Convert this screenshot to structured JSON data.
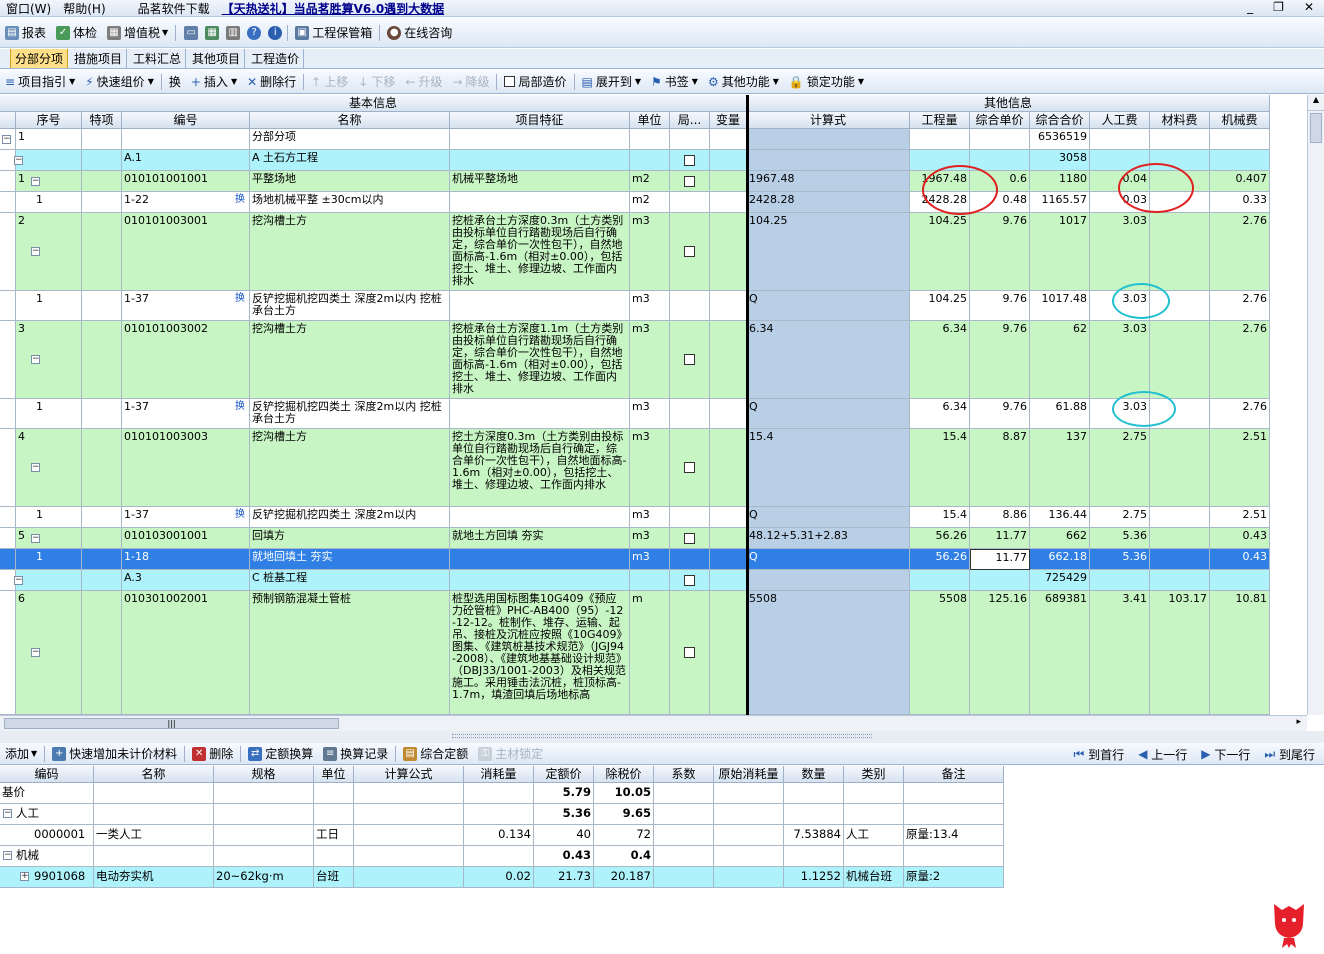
{
  "menu": {
    "items": [
      "窗口(W)",
      "帮助(H)",
      "品茗软件下载"
    ],
    "promo": "【天热送礼】当品茗胜算V6.0遇到大数据",
    "controls": [
      "_",
      "❐",
      "✕"
    ]
  },
  "toolbar1": [
    "报表",
    "体检",
    "增值税",
    "工程保管箱",
    "在线咨询"
  ],
  "tabs": [
    "分部分项",
    "措施项目",
    "工料汇总",
    "其他项目",
    "工程造价"
  ],
  "toolbar2": [
    {
      "label": "项目指引",
      "dd": true
    },
    {
      "label": "快速组价",
      "dd": true
    },
    {
      "label": "换"
    },
    {
      "label": "插入",
      "dd": true
    },
    {
      "label": "删除行"
    },
    {
      "label": "上移",
      "dis": true
    },
    {
      "label": "下移",
      "dis": true
    },
    {
      "label": "升级",
      "dis": true
    },
    {
      "label": "降级",
      "dis": true
    },
    {
      "label": "局部造价",
      "chk": true
    },
    {
      "label": "展开到",
      "dd": true
    },
    {
      "label": "书签",
      "dd": true
    },
    {
      "label": "其他功能",
      "dd": true
    },
    {
      "label": "锁定功能",
      "dd": true
    }
  ],
  "grid": {
    "group_basic": "基本信息",
    "group_other": "其他信息",
    "headers": [
      "序号",
      "特项",
      "编号",
      "名称",
      "项目特征",
      "单位",
      "局...",
      "变量",
      "计算式",
      "工程量",
      "综合单价",
      "综合合价",
      "人工费",
      "材料费",
      "机械费"
    ],
    "rows": [
      {
        "type": "root",
        "h": 21,
        "seq": "1",
        "name": "分部分项",
        "total": "6536519"
      },
      {
        "type": "section",
        "h": 21,
        "code": "A.1",
        "name": "A 土石方工程",
        "chk": true,
        "total": "3058"
      },
      {
        "type": "item",
        "h": 21,
        "seq": "1",
        "code": "010101001001",
        "name": "平整场地",
        "feat": "机械平整场地",
        "unit": "m2",
        "chk": true,
        "expr": "1967.48",
        "qty": "1967.48",
        "price": "0.6",
        "total": "1180",
        "labor": "0.04",
        "mat": "",
        "mach": "0.407"
      },
      {
        "type": "quota",
        "h": 21,
        "seq": "1",
        "code": "1-22",
        "huan": true,
        "name": "场地机械平整 ±30cm以内",
        "feat": "",
        "unit": "m2",
        "expr": "2428.28",
        "qty": "2428.28",
        "price": "0.48",
        "total": "1165.57",
        "labor": "0.03",
        "mat": "",
        "mach": "0.33"
      },
      {
        "type": "item",
        "h": 78,
        "seq": "2",
        "code": "010101003001",
        "name": "挖沟槽土方",
        "feat": "挖桩承台土方深度0.3m（土方类别由投标单位自行踏勘现场后自行确定，综合单价一次性包干），自然地面标高-1.6m（相对±0.00），包括挖土、堆土、修理边坡、工作面内排水",
        "unit": "m3",
        "chk": true,
        "expr": "104.25",
        "qty": "104.25",
        "price": "9.76",
        "total": "1017",
        "labor": "3.03",
        "mat": "",
        "mach": "2.76"
      },
      {
        "type": "quota",
        "h": 30,
        "seq": "1",
        "code": "1-37",
        "huan": true,
        "name": "反铲挖掘机挖四类土 深度2m以内 挖桩承台土方",
        "feat": "",
        "unit": "m3",
        "expr": "Q",
        "qty": "104.25",
        "price": "9.76",
        "total": "1017.48",
        "labor": "3.03",
        "mat": "",
        "mach": "2.76"
      },
      {
        "type": "item",
        "h": 78,
        "seq": "3",
        "code": "010101003002",
        "name": "挖沟槽土方",
        "feat": "挖桩承台土方深度1.1m（土方类别由投标单位自行踏勘现场后自行确定，综合单价一次性包干），自然地面标高-1.6m（相对±0.00），包括挖土、堆土、修理边坡、工作面内排水",
        "unit": "m3",
        "chk": true,
        "expr": "6.34",
        "qty": "6.34",
        "price": "9.76",
        "total": "62",
        "labor": "3.03",
        "mat": "",
        "mach": "2.76"
      },
      {
        "type": "quota",
        "h": 30,
        "seq": "1",
        "code": "1-37",
        "huan": true,
        "name": "反铲挖掘机挖四类土 深度2m以内 挖桩承台土方",
        "feat": "",
        "unit": "m3",
        "expr": "Q",
        "qty": "6.34",
        "price": "9.76",
        "total": "61.88",
        "labor": "3.03",
        "mat": "",
        "mach": "2.76"
      },
      {
        "type": "item",
        "h": 78,
        "seq": "4",
        "code": "010101003003",
        "name": "挖沟槽土方",
        "feat": "挖土方深度0.3m（土方类别由投标单位自行踏勘现场后自行确定，综合单价一次性包干），自然地面标高-1.6m（相对±0.00），包括挖土、堆土、修理边坡、工作面内排水",
        "unit": "m3",
        "chk": true,
        "expr": "15.4",
        "qty": "15.4",
        "price": "8.87",
        "total": "137",
        "labor": "2.75",
        "mat": "",
        "mach": "2.51"
      },
      {
        "type": "quota",
        "h": 21,
        "seq": "1",
        "code": "1-37",
        "huan": true,
        "name": "反铲挖掘机挖四类土 深度2m以内",
        "feat": "",
        "unit": "m3",
        "expr": "Q",
        "qty": "15.4",
        "price": "8.86",
        "total": "136.44",
        "labor": "2.75",
        "mat": "",
        "mach": "2.51"
      },
      {
        "type": "item",
        "h": 21,
        "seq": "5",
        "code": "010103001001",
        "name": "回填方",
        "feat": "就地土方回填 夯实",
        "unit": "m3",
        "chk": true,
        "expr": "48.12+5.31+2.83",
        "qty": "56.26",
        "price": "11.77",
        "total": "662",
        "labor": "5.36",
        "mat": "",
        "mach": "0.43"
      },
      {
        "type": "selected",
        "h": 21,
        "seq": "1",
        "code": "1-18",
        "name": "就地回填土 夯实",
        "feat": "",
        "unit": "m3",
        "expr": "Q",
        "qty": "56.26",
        "price": "11.77",
        "total": "662.18",
        "labor": "5.36",
        "mat": "",
        "mach": "0.43"
      },
      {
        "type": "section",
        "h": 21,
        "code": "A.3",
        "name": "C 桩基工程",
        "chk": true,
        "total": "725429"
      },
      {
        "type": "item",
        "h": 124,
        "seq": "6",
        "code": "010301002001",
        "name": "预制钢筋混凝土管桩",
        "feat": "桩型选用国标图集10G409《预应力砼管桩》PHC-AB400（95）-12-12-12。桩制作、堆存、运输、起吊、接桩及沉桩应按照《10G409》图集、《建筑桩基技术规范》（JGJ94-2008）、《建筑地基基础设计规范》（DBJ33/1001-2003）及相关规范施工。采用锤击法沉桩，桩顶标高-1.7m，填渣回填后场地标高",
        "unit": "m",
        "chk": true,
        "expr": "5508",
        "qty": "5508",
        "price": "125.16",
        "total": "689381",
        "labor": "3.41",
        "mat": "103.17",
        "mach": "10.81"
      }
    ]
  },
  "toolbar3": [
    "添加",
    "快速增加未计价材料",
    "删除",
    "定额换算",
    "换算记录",
    "综合定额",
    "主材锁定"
  ],
  "nav": [
    "到首行",
    "上一行",
    "下一行",
    "到尾行"
  ],
  "subgrid": {
    "headers": [
      "编码",
      "名称",
      "规格",
      "单位",
      "计算公式",
      "消耗量",
      "定额价",
      "除税价",
      "系数",
      "原始消耗量",
      "数量",
      "类别",
      "备注"
    ],
    "rows": [
      {
        "kind": "base",
        "code": "基价",
        "quota": "5.79",
        "notax": "10.05"
      },
      {
        "kind": "group",
        "code": "人工",
        "quota": "5.36",
        "notax": "9.65"
      },
      {
        "kind": "detail",
        "code": "0000001",
        "name": "一类人工",
        "spec": "",
        "unit": "工日",
        "use": "0.134",
        "quota": "40",
        "notax": "72",
        "count": "7.53884",
        "cat": "人工",
        "note": "原量:13.4"
      },
      {
        "kind": "group",
        "code": "机械",
        "quota": "0.43",
        "notax": "0.4"
      },
      {
        "kind": "sel",
        "code": "9901068",
        "name": "电动夯实机",
        "spec": "20~62kg·m",
        "unit": "台班",
        "use": "0.02",
        "quota": "21.73",
        "notax": "20.187",
        "count": "1.1252",
        "cat": "机械台班",
        "note": "原量:2"
      }
    ]
  },
  "colors": {
    "green": "#c8f5c4",
    "cyan": "#aef2fb",
    "selected": "#2f7fe4",
    "expr_blue": "#b9cfe6",
    "red_circle": "#e02020",
    "cyan_circle": "#20c0d0"
  }
}
